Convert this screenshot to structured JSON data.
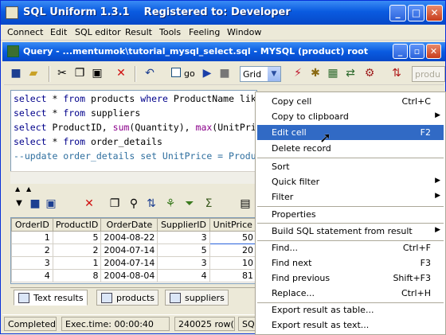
{
  "app": {
    "title": "SQL Uniform 1.3.1    Registered to: Developer"
  },
  "menubar": {
    "items": [
      "Connect",
      "Edit",
      "SQL editor",
      "Result",
      "Tools",
      "Feeling",
      "Window"
    ]
  },
  "child": {
    "title": "Query - ...mentumok\\tutorial_mysql_select.sql - MYSQL (product) root"
  },
  "toolbar": {
    "go_label": "go",
    "grid_select": "Grid",
    "product_field": "produ"
  },
  "editor": {
    "lines": [
      {
        "kw": "select",
        "rest": " * ",
        "kw2": "from",
        "rest2": " products ",
        "kw3": "where",
        "rest3": " ProductName lik"
      },
      {
        "kw": "select",
        "rest": " * ",
        "kw2": "from",
        "rest2": " suppliers"
      },
      {
        "kw": "select",
        "rest": " ProductID, ",
        "fn1": "sum",
        "rest2": "(Quantity), ",
        "fn2": "max",
        "rest3": "(UnitPric"
      },
      {
        "kw": "select",
        "rest": " * ",
        "kw2": "from",
        "rest2": " order_details"
      },
      {
        "comment": "--update order_details set UnitPrice = Produ"
      }
    ]
  },
  "grid": {
    "columns": [
      "OrderID",
      "ProductID",
      "OrderDate",
      "SupplierID",
      "UnitPrice"
    ],
    "rows": [
      [
        "1",
        "5",
        "2004-08-22",
        "3",
        "50"
      ],
      [
        "2",
        "2",
        "2004-07-14",
        "5",
        "20"
      ],
      [
        "3",
        "1",
        "2004-07-14",
        "3",
        "10"
      ],
      [
        "4",
        "8",
        "2004-08-04",
        "4",
        "81"
      ]
    ]
  },
  "tabs": [
    "Text results",
    "products",
    "suppliers"
  ],
  "status": {
    "state": "Completed",
    "exec": "Exec.time: 00:00:40",
    "rows": "240025 row(s)",
    "extra": "SQL"
  },
  "context_menu": {
    "copy_cell": {
      "label": "Copy cell",
      "shortcut": "Ctrl+C"
    },
    "copy_clipboard": {
      "label": "Copy to clipboard"
    },
    "edit_cell": {
      "label": "Edit cell",
      "shortcut": "F2"
    },
    "delete_record": {
      "label": "Delete record"
    },
    "sort": {
      "label": "Sort"
    },
    "quick_filter": {
      "label": "Quick filter"
    },
    "filter": {
      "label": "Filter"
    },
    "properties": {
      "label": "Properties"
    },
    "build_sql": {
      "label": "Build SQL statement from result"
    },
    "find": {
      "label": "Find...",
      "shortcut": "Ctrl+F"
    },
    "find_next": {
      "label": "Find next",
      "shortcut": "F3"
    },
    "find_previous": {
      "label": "Find previous",
      "shortcut": "Shift+F3"
    },
    "replace": {
      "label": "Replace...",
      "shortcut": "Ctrl+H"
    },
    "export_table": {
      "label": "Export result as table..."
    },
    "export_text": {
      "label": "Export result as text..."
    }
  }
}
